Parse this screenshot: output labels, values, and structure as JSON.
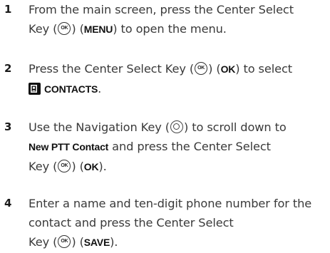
{
  "steps": [
    {
      "number": "1",
      "t1": "From the main screen, press the Center Select",
      "t2": "Key (",
      "key_label": "OK",
      "t3": ") (",
      "kw": "MENU",
      "t4": ") to open the menu."
    },
    {
      "number": "2",
      "t1": "Press the Center Select Key (",
      "key_label": "OK",
      "t2": ") (",
      "kw": "OK",
      "t3": ") to select",
      "icon": "contacts-icon",
      "kw2": "CONTACTS",
      "t4": "."
    },
    {
      "number": "3",
      "t1": "Use the Navigation Key (",
      "icon": "navigation-key-icon",
      "t2": ") to scroll down to",
      "kw": "New PTT Contact",
      "t3": " and press the Center Select",
      "t4": "Key (",
      "key_label": "OK",
      "t5": ") (",
      "kw2": "OK",
      "t6": ")."
    },
    {
      "number": "4",
      "t1": "Enter a name and ten-digit phone number for the",
      "t2": "contact and press the Center Select",
      "t3": "Key (",
      "key_label": "OK",
      "t4": ") (",
      "kw": "SAVE",
      "t5": ")."
    }
  ]
}
